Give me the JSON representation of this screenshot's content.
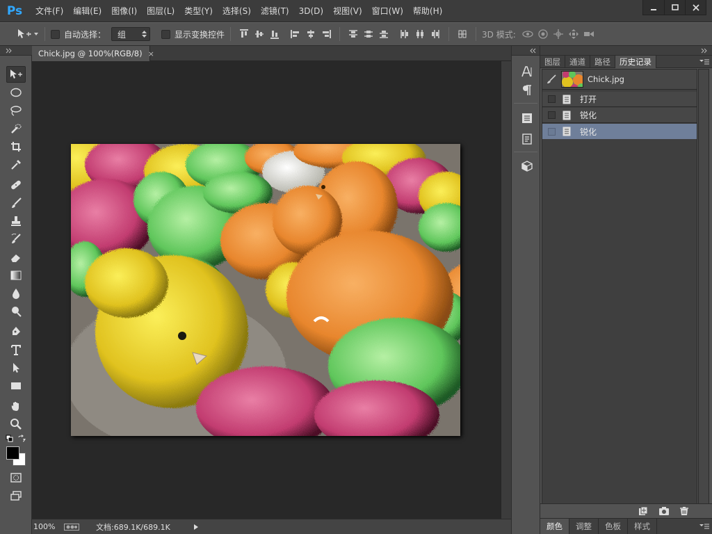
{
  "app": {
    "logo": "Ps",
    "accent": "#31a8ff"
  },
  "menu": [
    "文件(F)",
    "编辑(E)",
    "图像(I)",
    "图层(L)",
    "类型(Y)",
    "选择(S)",
    "滤镜(T)",
    "3D(D)",
    "视图(V)",
    "窗口(W)",
    "帮助(H)"
  ],
  "options": {
    "auto_select_label": "自动选择：",
    "auto_select_value": "组",
    "show_transform_label": "显示变换控件",
    "mode3d_label": "3D 模式:"
  },
  "document": {
    "tab_title": "Chick.jpg @ 100%(RGB/8)",
    "close_glyph": "×",
    "image_description": "colorful dyed chicks"
  },
  "status": {
    "zoom": "100%",
    "doc_info": "文档:689.1K/689.1K"
  },
  "history_panel": {
    "tabs": [
      "图层",
      "通道",
      "路径",
      "历史记录"
    ],
    "active_tab": 3,
    "snapshot_label": "Chick.jpg",
    "entries": [
      "打开",
      "锐化",
      "锐化"
    ],
    "selected_index": 2
  },
  "bottom_panel": {
    "tabs": [
      "颜色",
      "调整",
      "色板",
      "样式"
    ],
    "active_tab": 0
  },
  "colors": {
    "fg": "#000000",
    "bg": "#ffffff",
    "history_selected": "#6f7f9a"
  }
}
